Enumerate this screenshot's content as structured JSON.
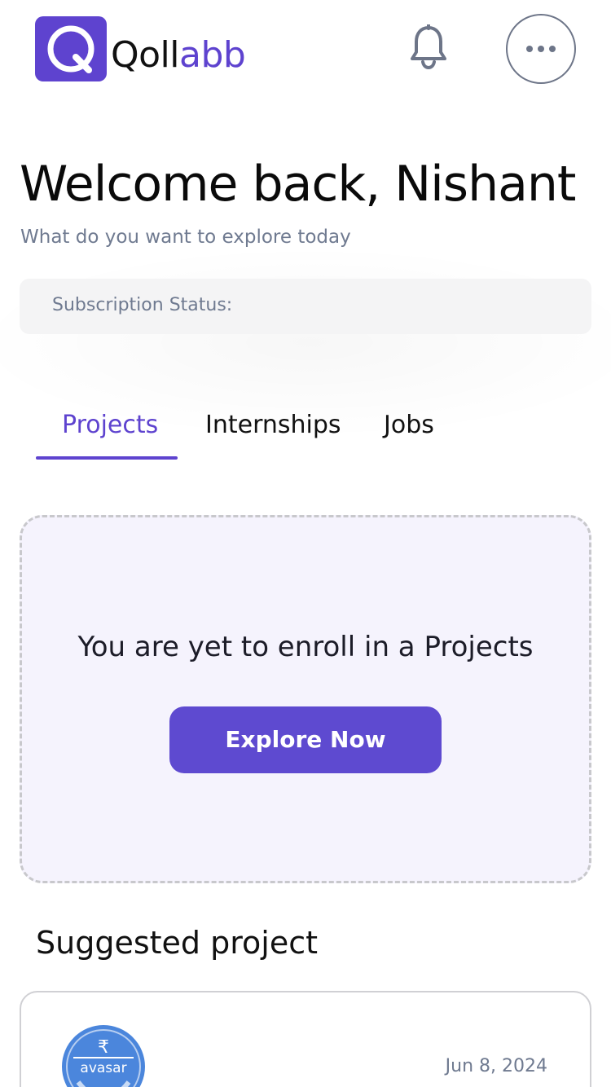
{
  "header": {
    "logo_text_part1": "Qoll",
    "logo_text_part2": "abb",
    "logo_icon": "logo-q-icon",
    "notification_icon": "bell-icon",
    "menu_icon": "more-horizontal-icon"
  },
  "welcome": {
    "title": "Welcome back, Nishant",
    "subtitle": "What do you want to explore today"
  },
  "subscription": {
    "label": "Subscription Status:"
  },
  "tabs": [
    {
      "label": "Projects",
      "active": true
    },
    {
      "label": "Internships",
      "active": false
    },
    {
      "label": "Jobs",
      "active": false
    }
  ],
  "empty_state": {
    "message": "You are yet to enroll in a Projects",
    "button_label": "Explore Now"
  },
  "suggested": {
    "title": "Suggested project",
    "card": {
      "logo_text": "avasar",
      "logo_symbol": "₹",
      "date": "Jun 8, 2024"
    }
  },
  "colors": {
    "accent": "#5e43cf",
    "card_bg": "#f5f3fd",
    "muted_text": "#6f7a90"
  }
}
